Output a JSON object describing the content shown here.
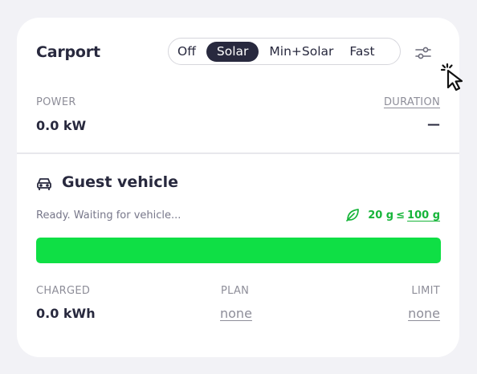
{
  "loadpoint": {
    "title": "Carport",
    "modes": [
      "Off",
      "Solar",
      "Min+Solar",
      "Fast"
    ],
    "active_mode": "Solar",
    "power_label": "POWER",
    "power_value": "0.0 kW",
    "duration_label": "DURATION",
    "duration_value": "—"
  },
  "vehicle": {
    "name": "Guest vehicle",
    "status": "Ready. Waiting for vehicle...",
    "co2_value": "20 g",
    "co2_sep": "≤",
    "co2_limit": "100 g",
    "progress_percent": 100,
    "charged_label": "CHARGED",
    "charged_value": "0.0 kWh",
    "plan_label": "PLAN",
    "plan_value": "none",
    "limit_label": "LIMIT",
    "limit_value": "none"
  },
  "colors": {
    "accent_dark": "#28293e",
    "green": "#17b53a",
    "progress_green": "#0fdf45"
  },
  "icons": {
    "settings": "sliders-icon",
    "vehicle": "car-icon",
    "co2": "leaf-icon",
    "cursor": "click-pointer-icon"
  }
}
